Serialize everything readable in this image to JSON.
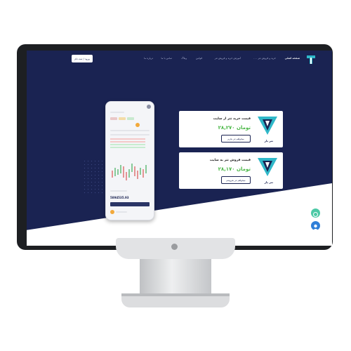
{
  "colors": {
    "hero_bg": "#1a2352",
    "price_green": "#4cb848",
    "accent": "#1a2352"
  },
  "nav": {
    "items": [
      {
        "label": "صفحه اصلی",
        "active": true
      },
      {
        "label": "خرید و فروش تتر ۰۰۰",
        "active": false
      },
      {
        "label": "آموزش خرید و فروش تتر",
        "active": false
      },
      {
        "label": "قوانین",
        "active": false
      },
      {
        "label": "وبلاگ",
        "active": false
      },
      {
        "label": "تماس با ما",
        "active": false
      },
      {
        "label": "درباره ما",
        "active": false
      }
    ],
    "login_label": "ورود / ثبت نام"
  },
  "cards": [
    {
      "title": "قیمت خرید تتر از سایت",
      "price": "۲۸,۲۷۰ تومان",
      "button": "میخواهم تتر بخرم",
      "logo_text": "تتر یار"
    },
    {
      "title": "قیمت فروش تتر به سایت",
      "price": "۲۸,۱۷۰ تومان",
      "button": "میخواهم تتر بفروشم",
      "logo_text": "تتر یار"
    }
  ],
  "phone": {
    "balance": "5894535.93"
  },
  "chart_icons": {
    "chat": "chat-icon",
    "support": "support-agent-icon",
    "logo": "tether-logo-icon"
  }
}
